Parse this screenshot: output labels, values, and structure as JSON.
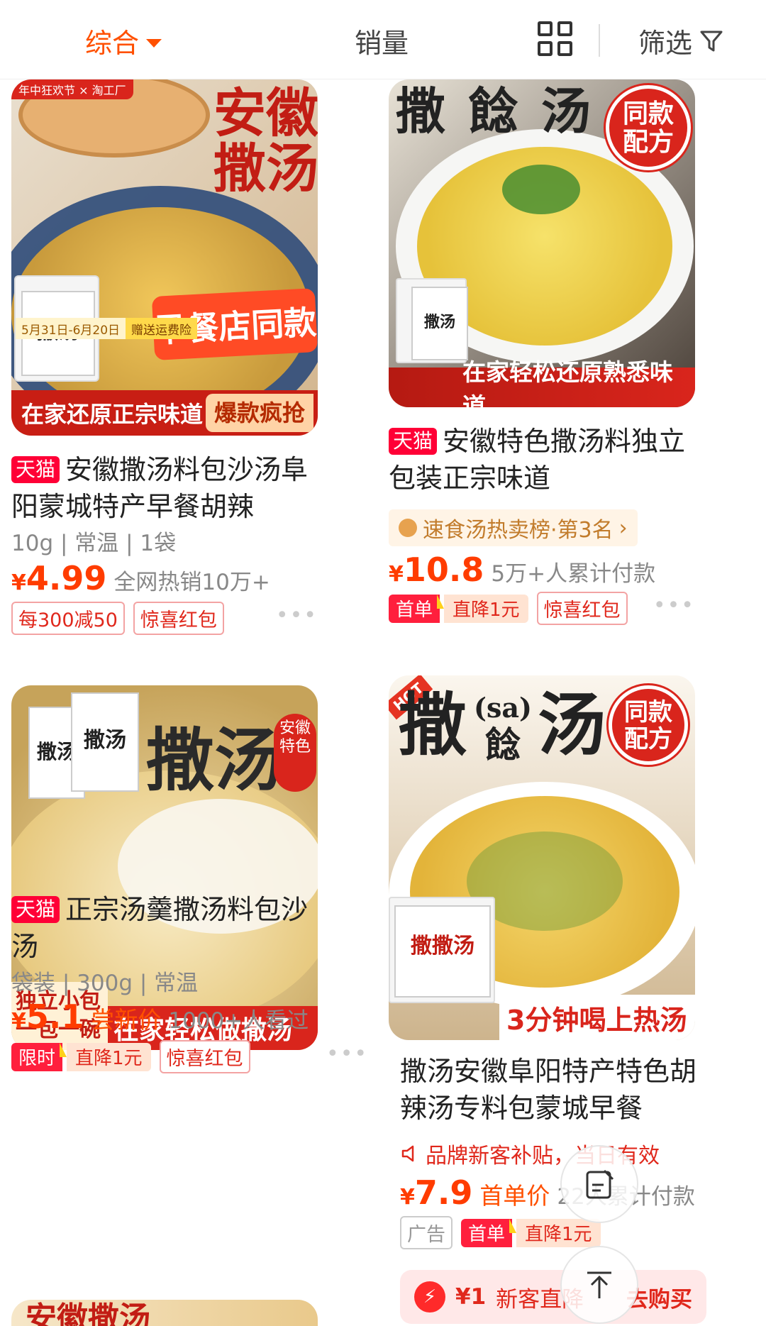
{
  "sort_bar": {
    "comprehensive": "综合",
    "sales": "销量",
    "filter": "筛选"
  },
  "products": [
    {
      "thumb_title": "安徽\n撒汤",
      "thumb_top_banner": "年中狂欢节 × 淘工厂",
      "thumb_date_tag": "5月31日-6月20日",
      "thumb_date_tag2": "赠送运费险",
      "thumb_mid_text": "早餐店同款",
      "thumb_banner": "在家还原正宗味道",
      "thumb_banner2": "爆款疯抢",
      "packet_text": "撒汤",
      "store_badge": "天猫",
      "title": "安徽撒汤料包沙汤阜阳蒙城特产早餐胡辣",
      "specs": "10g | 常温 | 1袋",
      "price_yen": "¥",
      "price": "4.99",
      "sold": "全网热销10万+",
      "promos": [
        "每300减50",
        "惊喜红包"
      ]
    },
    {
      "thumb_title": "撒 䭃 汤",
      "thumb_badge": "同款\n配方",
      "thumb_banner": "在家轻松还原熟悉味道",
      "packet_text": "撒汤",
      "store_badge": "天猫",
      "title": "安徽特色撒汤料独立包装正宗味道",
      "rank": "速食汤热卖榜·第3名",
      "price_yen": "¥",
      "price": "10.8",
      "sold": "5万+人累计付款",
      "split_a": "首单",
      "split_b": "直降1元",
      "promo": "惊喜红包"
    },
    {
      "thumb_title": "撒汤",
      "thumb_side": "安徽\n特色",
      "thumb_banner_left": "独立小包\n一包一碗",
      "thumb_banner": "在家轻松做撒汤",
      "packet_text": "撒汤",
      "store_badge": "天猫",
      "title": "正宗汤羹撒汤料包沙汤",
      "specs": "袋装 | 300g | 常温",
      "price_yen": "¥",
      "price": "5.1",
      "price_note": "尝新价",
      "sold": "1000+人看过",
      "split_a": "限时",
      "split_b": "直降1元",
      "promo": "惊喜红包"
    },
    {
      "thumb_title": "撒",
      "thumb_title_small": "(sa)",
      "thumb_title_sub": "䭃",
      "thumb_title2": "汤",
      "thumb_hot": "HOT",
      "thumb_badge": "同款\n配方",
      "thumb_banner": "3分钟喝上热汤",
      "packet_text": "撒撒汤",
      "title": "撒汤安徽阜阳特产特色胡辣汤专料包蒙城早餐",
      "ad_line": "品牌新客补贴，当日有效",
      "price_yen": "¥",
      "price": "7.9",
      "price_note": "首单价",
      "sold": "22人累计付款",
      "ad_tag": "广告",
      "split_a": "首单",
      "split_b": "直降1元",
      "cta_amount": "¥1",
      "cta_text": "新客直降",
      "cta_buy": "去购买"
    }
  ],
  "bottom_peek": {
    "thumb_title": "安徽撒汤"
  },
  "more_dots": "•••"
}
